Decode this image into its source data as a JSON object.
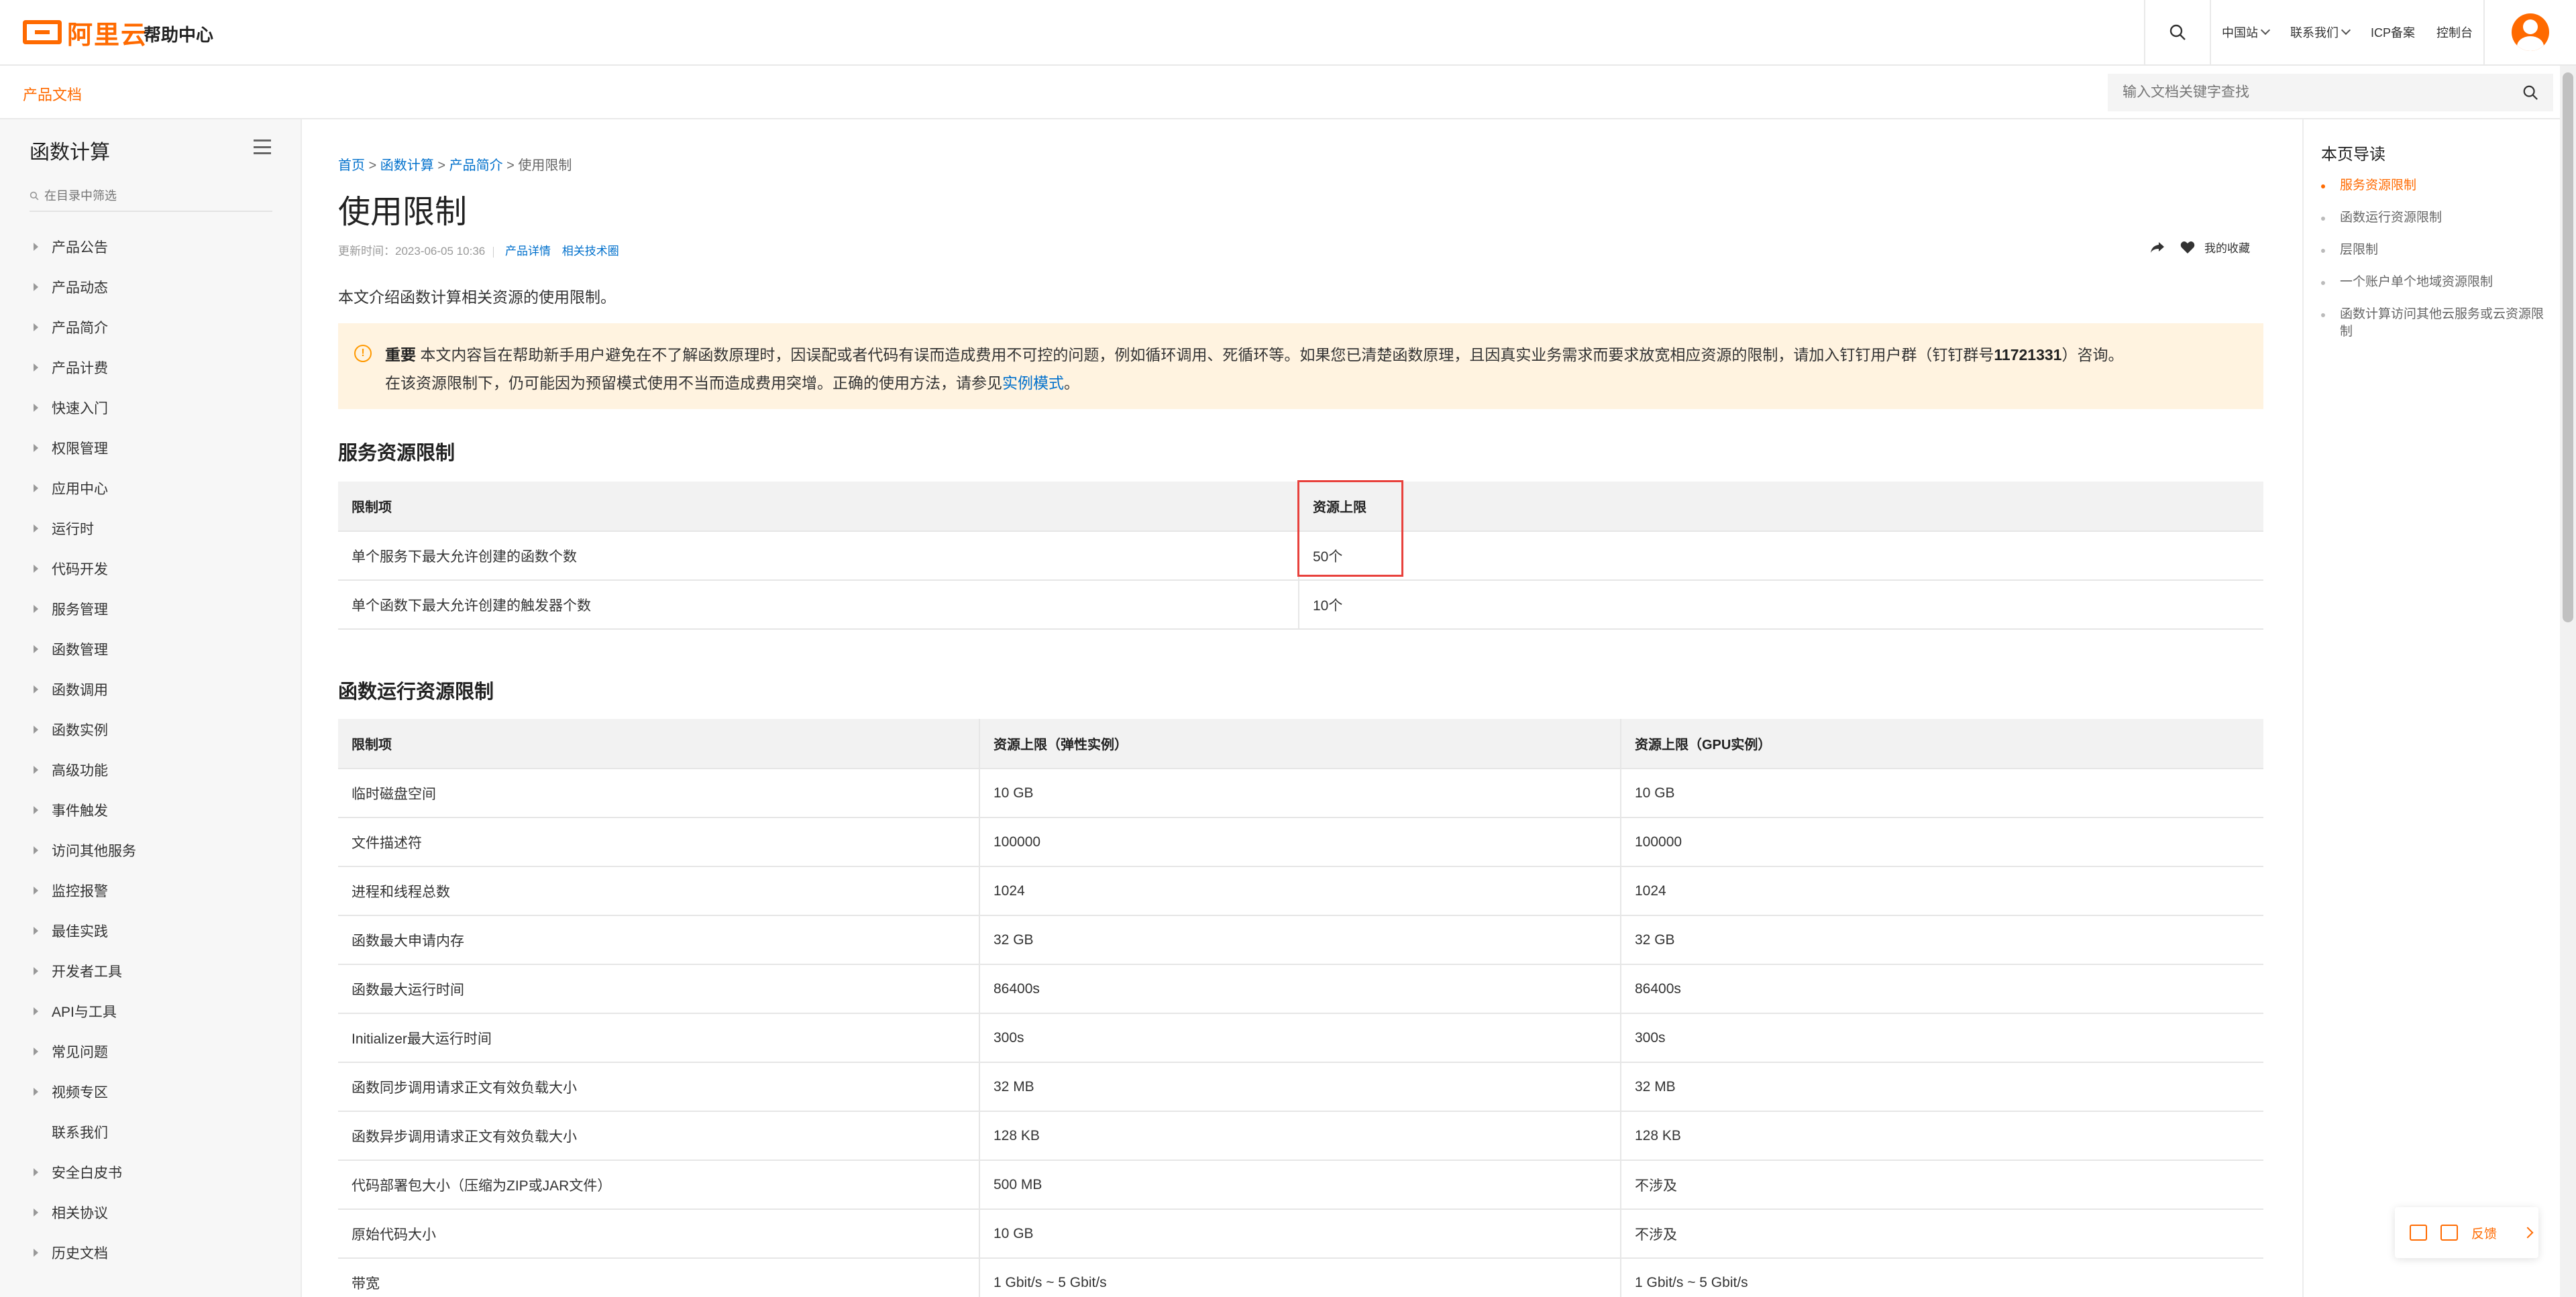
{
  "header": {
    "logo_text": "阿里云",
    "help_center": "帮助中心",
    "links": [
      "中国站",
      "联系我们",
      "ICP备案",
      "控制台"
    ]
  },
  "subbar": {
    "product_docs": "产品文档",
    "search_placeholder": "输入文档关键字查找"
  },
  "sidebar": {
    "title": "函数计算",
    "filter_placeholder": "在目录中筛选",
    "items": [
      {
        "label": "产品公告",
        "arrow": true
      },
      {
        "label": "产品动态",
        "arrow": true
      },
      {
        "label": "产品简介",
        "arrow": true
      },
      {
        "label": "产品计费",
        "arrow": true
      },
      {
        "label": "快速入门",
        "arrow": true
      },
      {
        "label": "权限管理",
        "arrow": true
      },
      {
        "label": "应用中心",
        "arrow": true
      },
      {
        "label": "运行时",
        "arrow": true
      },
      {
        "label": "代码开发",
        "arrow": true
      },
      {
        "label": "服务管理",
        "arrow": true
      },
      {
        "label": "函数管理",
        "arrow": true
      },
      {
        "label": "函数调用",
        "arrow": true
      },
      {
        "label": "函数实例",
        "arrow": true
      },
      {
        "label": "高级功能",
        "arrow": true
      },
      {
        "label": "事件触发",
        "arrow": true
      },
      {
        "label": "访问其他服务",
        "arrow": true
      },
      {
        "label": "监控报警",
        "arrow": true
      },
      {
        "label": "最佳实践",
        "arrow": true
      },
      {
        "label": "开发者工具",
        "arrow": true
      },
      {
        "label": "API与工具",
        "arrow": true
      },
      {
        "label": "常见问题",
        "arrow": true
      },
      {
        "label": "视频专区",
        "arrow": true
      },
      {
        "label": "联系我们",
        "arrow": false
      },
      {
        "label": "安全白皮书",
        "arrow": true
      },
      {
        "label": "相关协议",
        "arrow": true
      },
      {
        "label": "历史文档",
        "arrow": true
      }
    ]
  },
  "main": {
    "breadcrumb": [
      "首页",
      "函数计算",
      "产品简介",
      "使用限制"
    ],
    "title": "使用限制",
    "updated": "更新时间：2023-06-05 10:36",
    "meta_links": [
      "产品详情",
      "相关技术圈"
    ],
    "favorite": "我的收藏",
    "intro": "本文介绍函数计算相关资源的使用限制。",
    "notice": {
      "label": "重要",
      "line1_a": " 本文内容旨在帮助新手用户避免在不了解函数原理时，因误配或者代码有误而造成费用不可控的问题，例如循环调用、死循环等。如果您已清楚函数原理，且因真实业务需求而要求放宽相应资源的限制，请加入钉钉用户群（钉钉群号",
      "group_no": "11721331",
      "line1_b": "）咨询。",
      "line2_a": "在该资源限制下，仍可能因为预留模式使用不当而造成费用突增。正确的使用方法，请参见",
      "line2_link": "实例模式",
      "line2_b": "。"
    },
    "section1": {
      "title": "服务资源限制",
      "headers": [
        "限制项",
        "资源上限"
      ],
      "rows": [
        [
          "单个服务下最大允许创建的函数个数",
          "50个"
        ],
        [
          "单个函数下最大允许创建的触发器个数",
          "10个"
        ]
      ]
    },
    "section2": {
      "title": "函数运行资源限制",
      "headers": [
        "限制项",
        "资源上限（弹性实例）",
        "资源上限（GPU实例）"
      ],
      "rows": [
        [
          "临时磁盘空间",
          "10 GB",
          "10 GB"
        ],
        [
          "文件描述符",
          "100000",
          "100000"
        ],
        [
          "进程和线程总数",
          "1024",
          "1024"
        ],
        [
          "函数最大申请内存",
          "32 GB",
          "32 GB"
        ],
        [
          "函数最大运行时间",
          "86400s",
          "86400s"
        ],
        [
          "Initializer最大运行时间",
          "300s",
          "300s"
        ],
        [
          "函数同步调用请求正文有效负载大小",
          "32 MB",
          "32 MB"
        ],
        [
          "函数异步调用请求正文有效负载大小",
          "128 KB",
          "128 KB"
        ],
        [
          "代码部署包大小（压缩为ZIP或JAR文件）",
          "500 MB",
          "不涉及"
        ],
        [
          "原始代码大小",
          "10 GB",
          "不涉及"
        ],
        [
          "带宽",
          "1 Gbit/s ~ 5 Gbit/s",
          "1 Gbit/s ~ 5 Gbit/s"
        ]
      ]
    }
  },
  "toc": {
    "title": "本页导读",
    "items": [
      {
        "label": "服务资源限制",
        "active": true
      },
      {
        "label": "函数运行资源限制",
        "active": false
      },
      {
        "label": "层限制",
        "active": false
      },
      {
        "label": "一个账户单个地域资源限制",
        "active": false
      },
      {
        "label": "函数计算访问其他云服务或云资源限制",
        "active": false
      }
    ]
  },
  "feedback": {
    "label": "反馈"
  },
  "colors": {
    "brand": "#ff6a00",
    "link": "#0070cc",
    "notice_bg": "#fff3e0",
    "highlight": "#e8413c"
  }
}
